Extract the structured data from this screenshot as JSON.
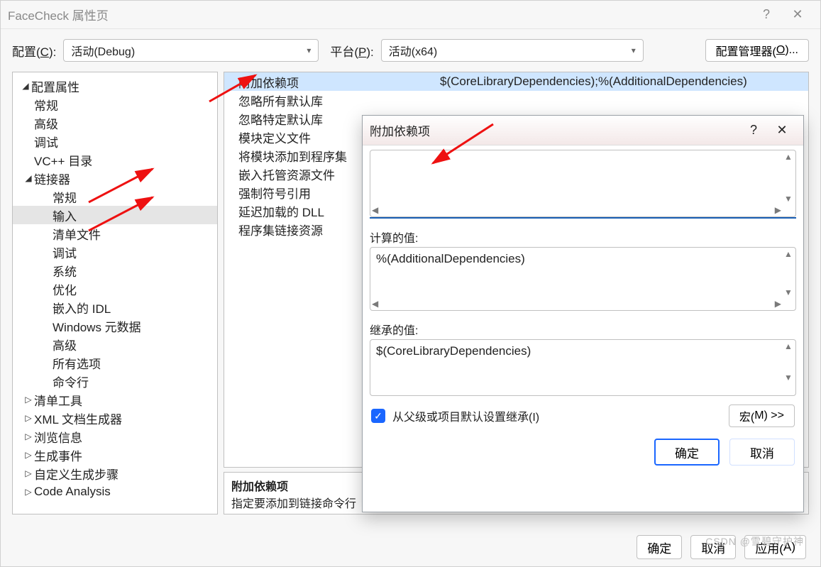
{
  "window": {
    "title": "FaceCheck 属性页",
    "help_label": "?",
    "close_label": "✕"
  },
  "toolbar": {
    "config_label_prefix": "配置(",
    "config_label_key": "C",
    "config_label_suffix": "):",
    "config_value": "活动(Debug)",
    "platform_label_prefix": "平台(",
    "platform_label_key": "P",
    "platform_label_suffix": "):",
    "platform_value": "活动(x64)",
    "config_mgr_prefix": "配置管理器(",
    "config_mgr_key": "O",
    "config_mgr_suffix": ")..."
  },
  "tree": {
    "root": "配置属性",
    "items_lvl1": [
      "常规",
      "高级",
      "调试",
      "VC++ 目录"
    ],
    "linker": "链接器",
    "linker_children": [
      "常规",
      "输入",
      "清单文件",
      "调试",
      "系统",
      "优化",
      "嵌入的 IDL",
      "Windows 元数据",
      "高级",
      "所有选项",
      "命令行"
    ],
    "collapsed": [
      "清单工具",
      "XML 文档生成器",
      "浏览信息",
      "生成事件",
      "自定义生成步骤",
      "Code Analysis"
    ]
  },
  "props": {
    "rows": [
      {
        "name": "附加依赖项",
        "value": "$(CoreLibraryDependencies);%(AdditionalDependencies)"
      },
      {
        "name": "忽略所有默认库",
        "value": ""
      },
      {
        "name": "忽略特定默认库",
        "value": ""
      },
      {
        "name": "模块定义文件",
        "value": ""
      },
      {
        "name": "将模块添加到程序集",
        "value": ""
      },
      {
        "name": "嵌入托管资源文件",
        "value": ""
      },
      {
        "name": "强制符号引用",
        "value": ""
      },
      {
        "name": "延迟加载的 DLL",
        "value": ""
      },
      {
        "name": "程序集链接资源",
        "value": ""
      }
    ],
    "desc_title": "附加依赖项",
    "desc_body": "指定要添加到链接命令行"
  },
  "popup": {
    "title": "附加依赖项",
    "help": "?",
    "close": "✕",
    "edit_value": "",
    "computed_label": "计算的值:",
    "computed_value": "%(AdditionalDependencies)",
    "inherited_label": "继承的值:",
    "inherited_value": "$(CoreLibraryDependencies)",
    "inherit_cb_prefix": "从父级或项目默认设置继承(",
    "inherit_cb_key": "I",
    "inherit_cb_suffix": ")",
    "macros_prefix": "宏(",
    "macros_key": "M",
    "macros_suffix": ") >>",
    "ok": "确定",
    "cancel": "取消"
  },
  "actions": {
    "ok": "确定",
    "cancel": "取消",
    "apply_prefix": "应用(",
    "apply_key": "A",
    "apply_suffix": ")"
  },
  "watermark": "CSDN @雪碧守护神"
}
